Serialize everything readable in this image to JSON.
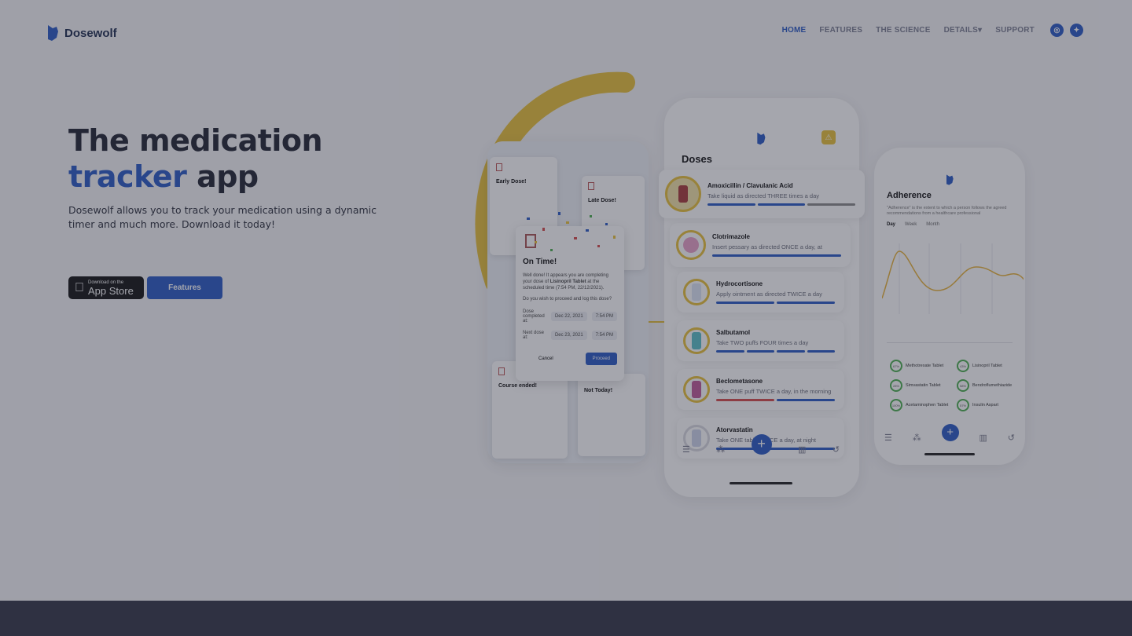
{
  "brand": {
    "name": "Dosewolf"
  },
  "nav": {
    "items": [
      "HOME",
      "FEATURES",
      "THE SCIENCE",
      "DETAILS",
      "SUPPORT"
    ],
    "details_caret": "▾",
    "social": [
      "instagram-icon",
      "twitter-icon"
    ]
  },
  "hero": {
    "title_line1": "The medication",
    "title_accent": "tracker",
    "title_rest": "app",
    "subtitle": "Dosewolf allows you to track your medication using a dynamic timer and much more. Download it today!",
    "appstore_small": "Download on the",
    "appstore_big": "App Store",
    "features_button": "Features"
  },
  "colors": {
    "accent": "#2a5bc4",
    "ring": "#e9c23a",
    "overlay": "rgba(40,42,60,0.42)",
    "footer": "#2f3142"
  },
  "doses_phone": {
    "title": "Doses",
    "items": [
      {
        "name": "Amoxicillin / Clavulanic Acid",
        "desc": "Take liquid as directed THREE times a day"
      },
      {
        "name": "Clotrimazole",
        "desc": "Insert pessary as directed ONCE a day, at"
      },
      {
        "name": "Hydrocortisone",
        "desc": "Apply ointment as directed TWICE a day"
      },
      {
        "name": "Salbutamol",
        "desc": "Take TWO puffs FOUR times a day"
      },
      {
        "name": "Beclometasone",
        "desc": "Take ONE puff TWICE a day, in the morning"
      },
      {
        "name": "Atorvastatin",
        "desc": "Take ONE tablet ONCE a day, at night"
      }
    ]
  },
  "dialogs": {
    "early": {
      "title": "Early Dose!"
    },
    "late": {
      "title": "Late Dose!"
    },
    "course": {
      "title": "Course ended!"
    },
    "nottoday": {
      "title": "Not Today!"
    },
    "ontime": {
      "title": "On Time!",
      "body_pre": "Well done! It appears you are completing your dose of",
      "body_med": "Lisinopril Tablet",
      "body_post": "at the scheduled time (7:54 PM, 22/12/2021).",
      "question": "Do you wish to proceed and log this dose?",
      "row1_label": "Dose completed at:",
      "row1_date": "Dec 22, 2021",
      "row1_time": "7:54 PM",
      "row2_label": "Next dose at:",
      "row2_date": "Dec 23, 2021",
      "row2_time": "7:54 PM",
      "cancel": "Cancel",
      "proceed": "Proceed"
    }
  },
  "adherence_phone": {
    "title": "Adherence",
    "subtitle": "\"Adherence\" is the extent to which a person follows the agreed recommendations from a healthcare professional",
    "tabs": [
      "Day",
      "Week",
      "Month"
    ],
    "meds": [
      {
        "name": "Methotrexate Tablet",
        "pct": "67%"
      },
      {
        "name": "Lisinopril Tablet",
        "pct": "43%"
      },
      {
        "name": "Simvastatin Tablet",
        "pct": "28%"
      },
      {
        "name": "Bendroflumethiazide",
        "pct": "58%"
      },
      {
        "name": "Acetaminophen Tablet",
        "pct": "100%"
      },
      {
        "name": "Insulin Aspart",
        "pct": "57%"
      }
    ]
  }
}
